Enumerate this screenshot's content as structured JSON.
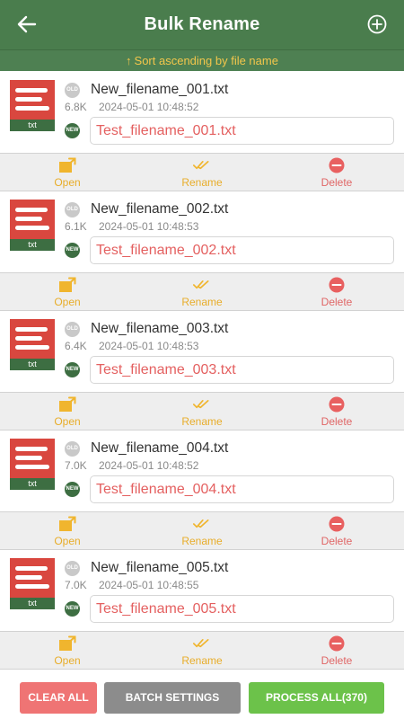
{
  "header": {
    "title": "Bulk Rename",
    "back_icon": "arrow-left-icon",
    "add_icon": "plus-circle-icon"
  },
  "sort": {
    "arrow": "↑",
    "label": "Sort ascending by file name"
  },
  "badges": {
    "old": "OLD",
    "new": "NEW"
  },
  "file_type_label": "txt",
  "actions": {
    "open": "Open",
    "rename": "Rename",
    "delete": "Delete"
  },
  "files": [
    {
      "old_name": "New_filename_001.txt",
      "size": "6.8K",
      "date": "2024-05-01 10:48:52",
      "new_name": "Test_filename_001.txt"
    },
    {
      "old_name": "New_filename_002.txt",
      "size": "6.1K",
      "date": "2024-05-01 10:48:53",
      "new_name": "Test_filename_002.txt"
    },
    {
      "old_name": "New_filename_003.txt",
      "size": "6.4K",
      "date": "2024-05-01 10:48:53",
      "new_name": "Test_filename_003.txt"
    },
    {
      "old_name": "New_filename_004.txt",
      "size": "7.0K",
      "date": "2024-05-01 10:48:52",
      "new_name": "Test_filename_004.txt"
    },
    {
      "old_name": "New_filename_005.txt",
      "size": "7.0K",
      "date": "2024-05-01 10:48:55",
      "new_name": "Test_filename_005.txt"
    }
  ],
  "buttons": {
    "clear_all": "CLEAR ALL",
    "batch_settings": "BATCH SETTINGS",
    "process_all": "PROCESS ALL(370)"
  },
  "colors": {
    "header_green": "#4a7d4d",
    "sort_text": "#f3c64b",
    "new_name_red": "#e46060",
    "action_orange": "#e8ad2a",
    "delete_red": "#e06666",
    "clear_button": "#ef7474",
    "batch_button": "#8c8c8c",
    "process_button": "#6cc24a"
  }
}
